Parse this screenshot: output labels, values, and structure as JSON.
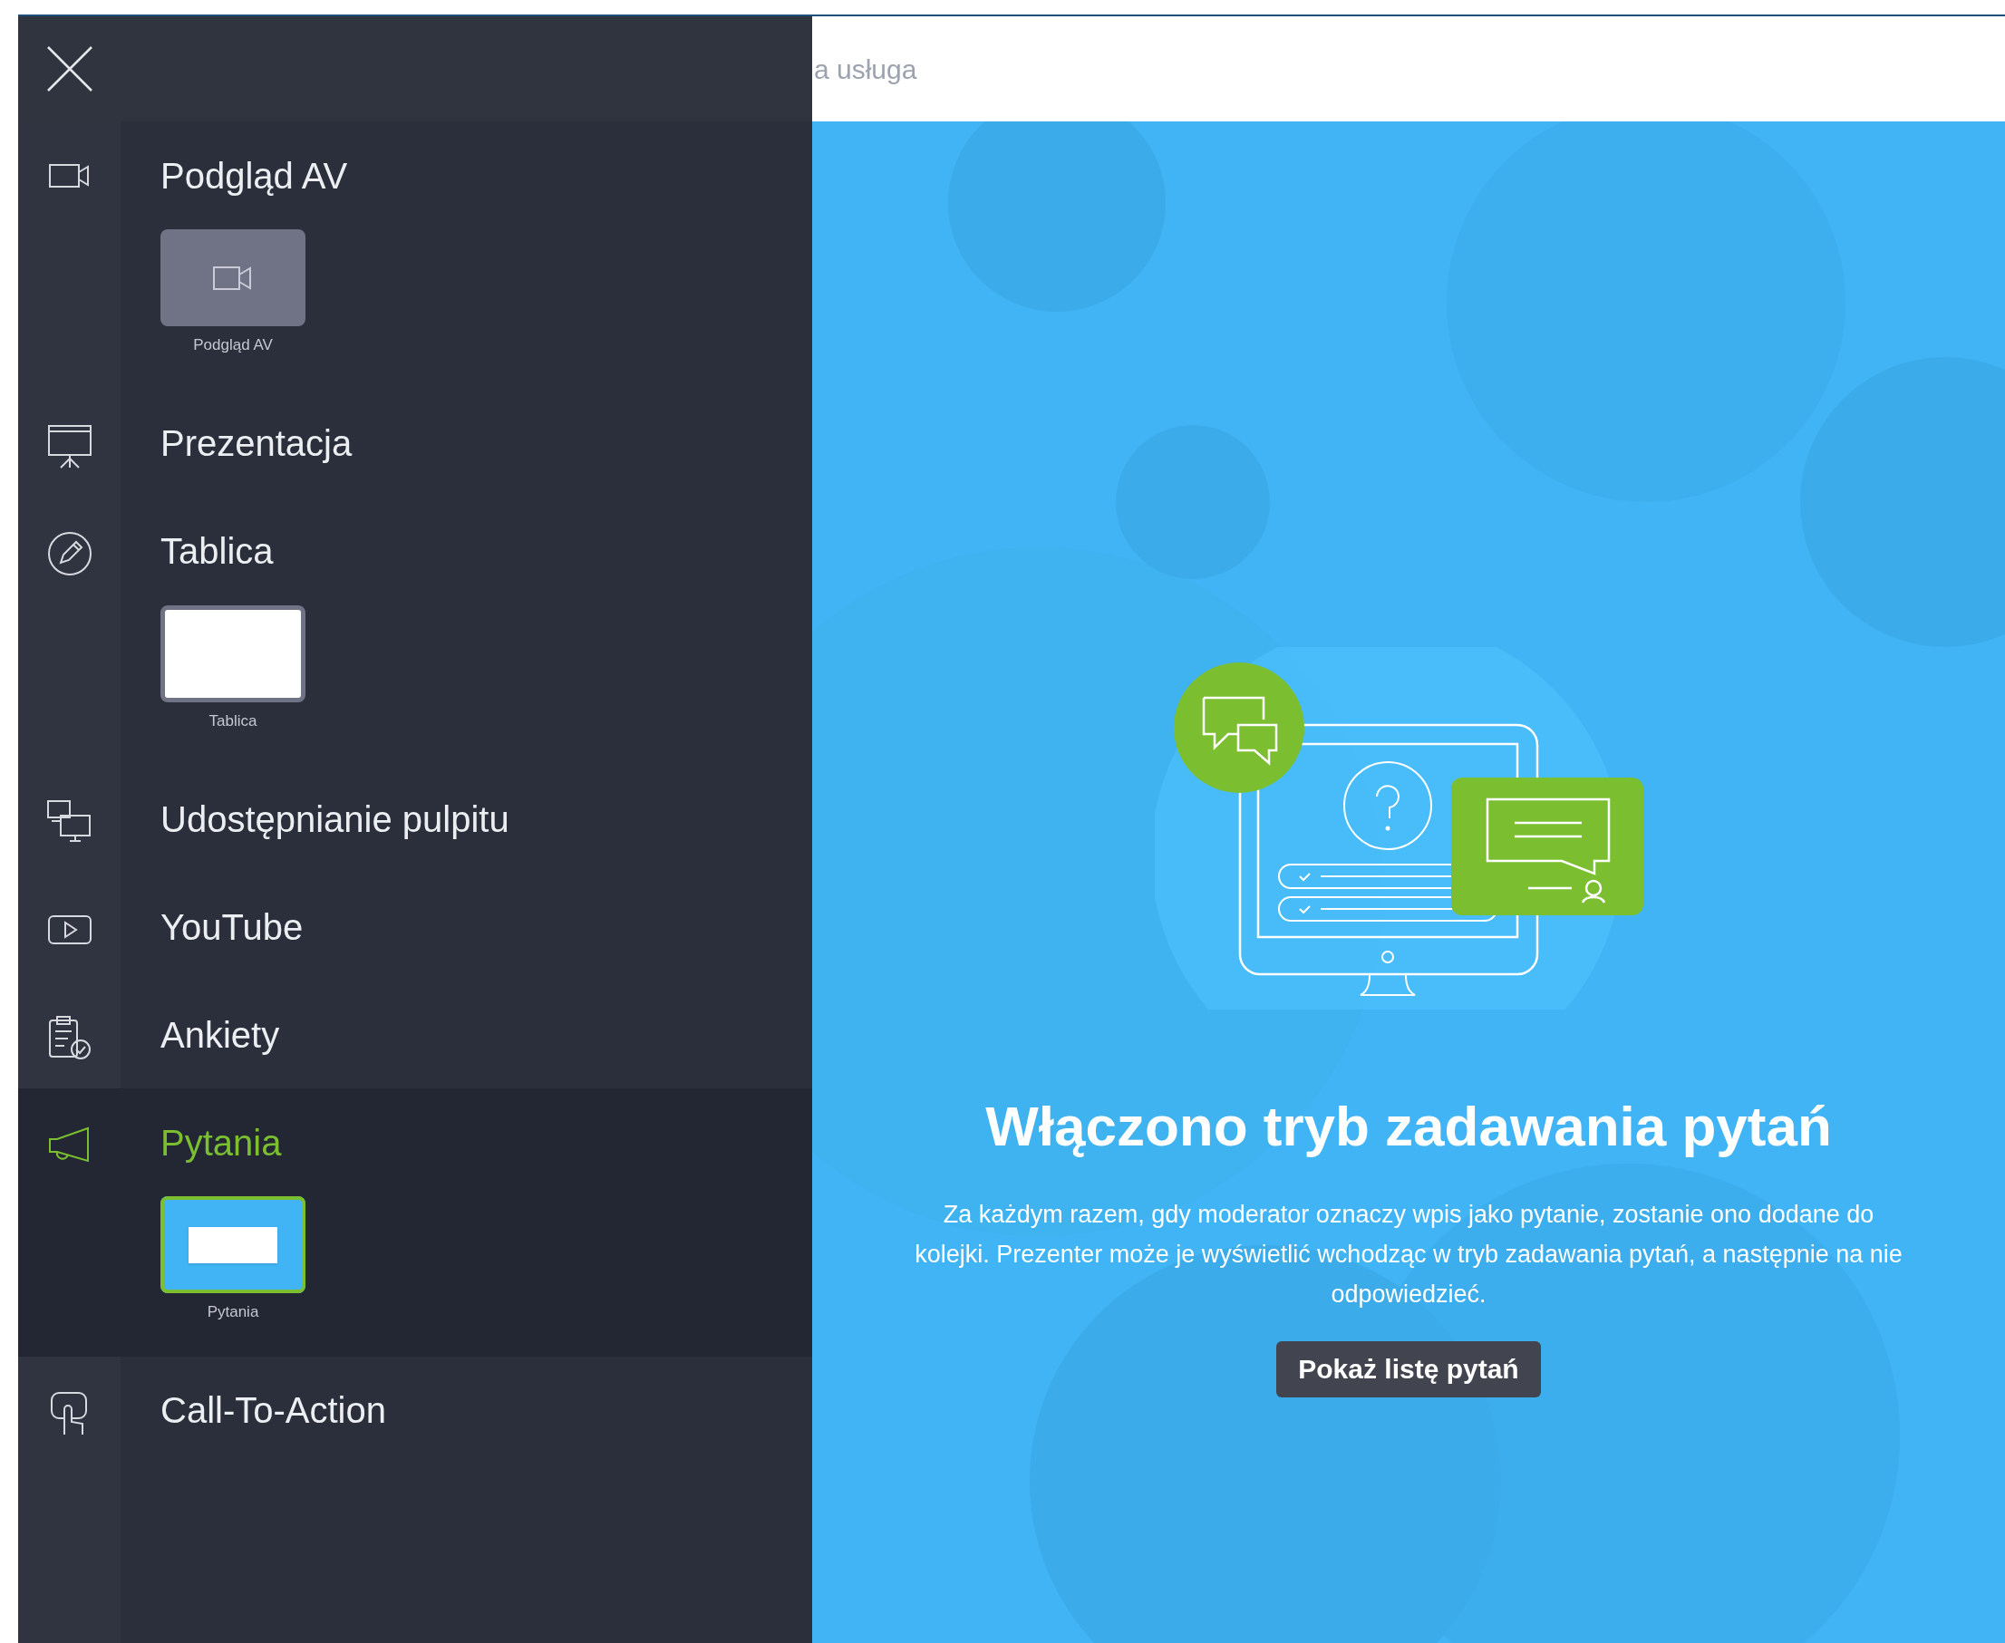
{
  "header": {
    "title": "a usługa"
  },
  "sidebar": {
    "items": [
      {
        "kind": "camera",
        "label": "Podgląd AV",
        "selected": false,
        "thumbnail": {
          "kind": "camera",
          "label": "Podgląd AV"
        }
      },
      {
        "kind": "presentation",
        "label": "Prezentacja",
        "selected": false
      },
      {
        "kind": "pencil",
        "label": "Tablica",
        "selected": false,
        "thumbnail": {
          "kind": "whiteboard",
          "label": "Tablica"
        }
      },
      {
        "kind": "screens",
        "label": "Udostępnianie pulpitu",
        "selected": false
      },
      {
        "kind": "play",
        "label": "YouTube",
        "selected": false
      },
      {
        "kind": "clipboard",
        "label": "Ankiety",
        "selected": false
      },
      {
        "kind": "megaphone",
        "label": "Pytania",
        "selected": true,
        "thumbnail": {
          "kind": "questions",
          "label": "Pytania"
        }
      },
      {
        "kind": "hand",
        "label": "Call-To-Action",
        "selected": false
      }
    ]
  },
  "main": {
    "heading": "Włączono tryb zadawania pytań",
    "description": "Za każdym razem, gdy moderator oznaczy wpis jako pytanie, zostanie ono dodane do kolejki. Prezenter może je wyświetlić wchodząc w tryb zadawania pytań, a następnie na nie odpowiedzieć.",
    "button": "Pokaż listę pytań"
  }
}
